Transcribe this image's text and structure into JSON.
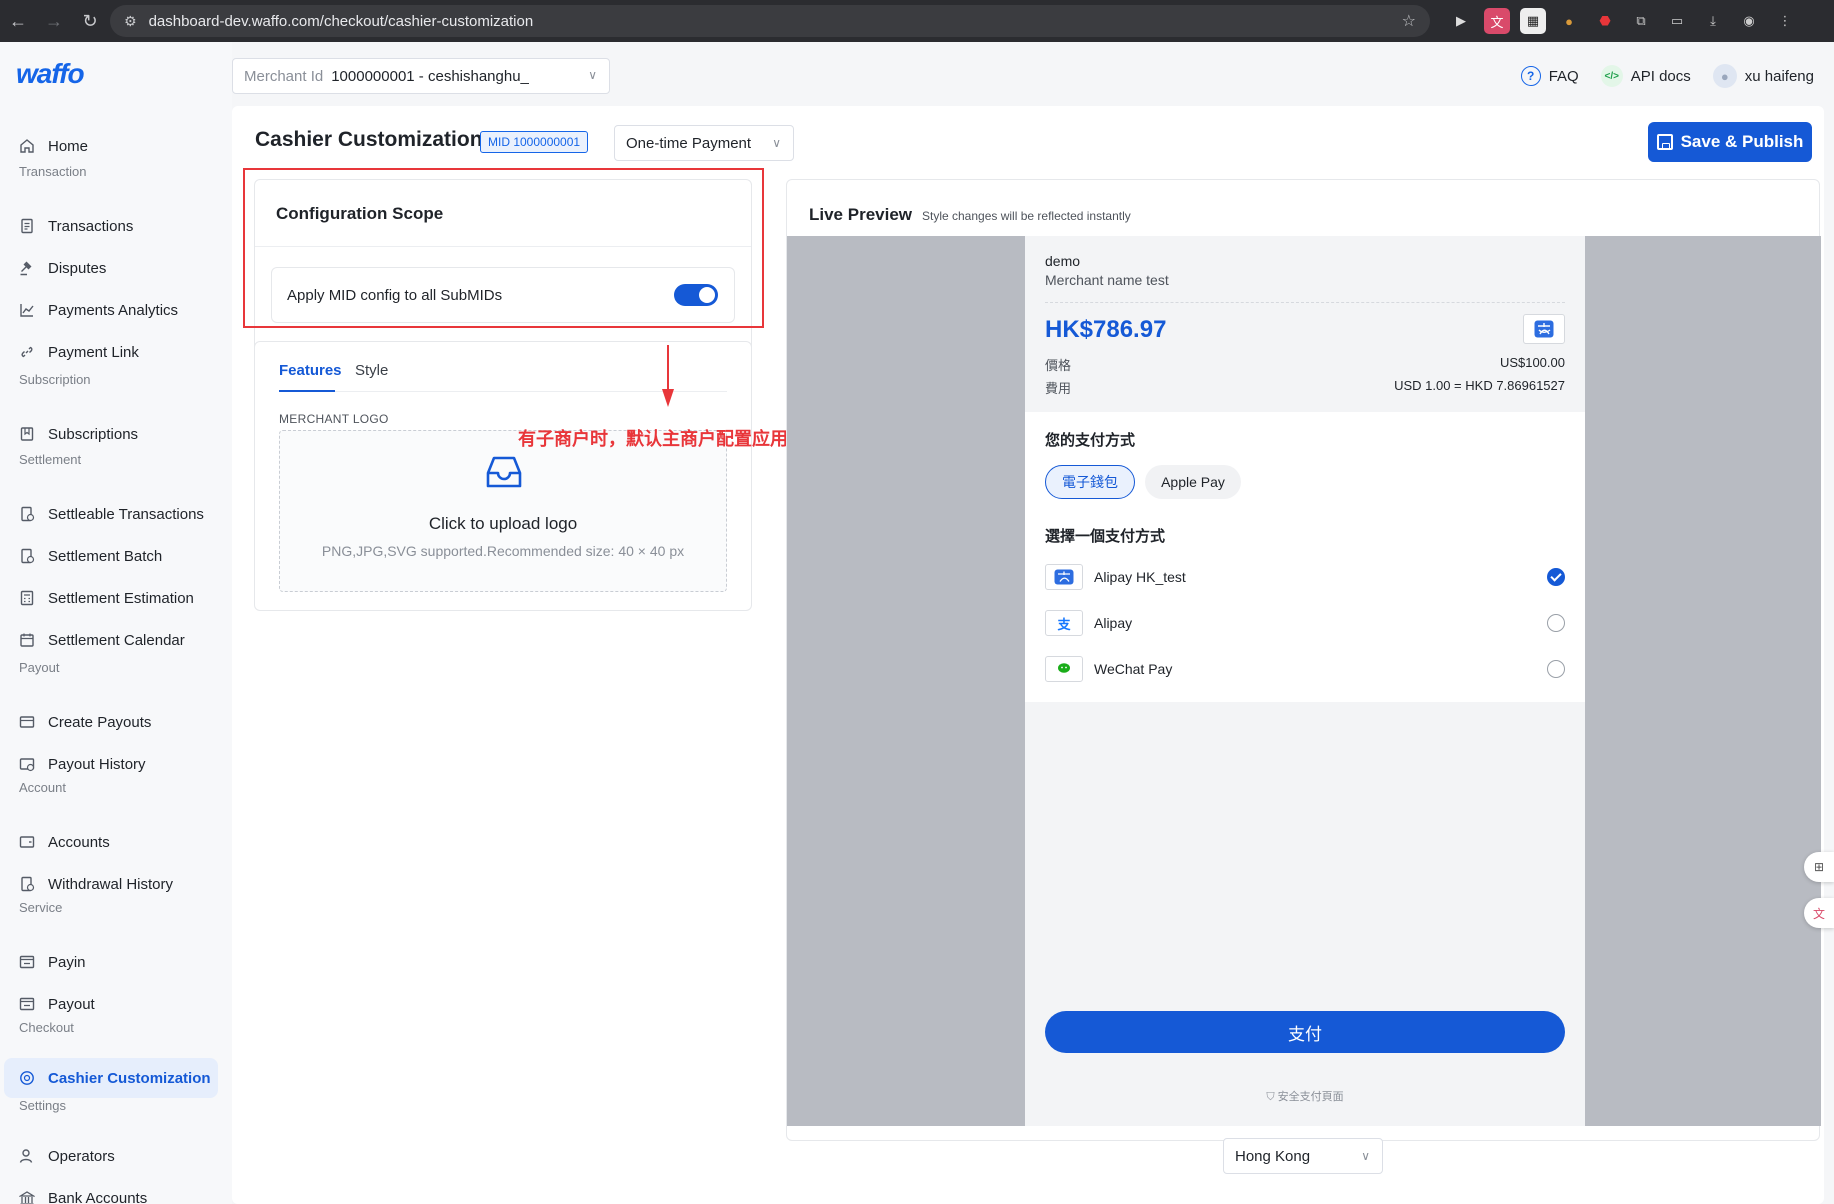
{
  "browser": {
    "url": "dashboard-dev.waffo.com/checkout/cashier-customization"
  },
  "brand": {
    "logo_text": "waffo",
    "accent": "#1559d6"
  },
  "header": {
    "merchant_label": "Merchant Id",
    "merchant_value": "1000000001 - ceshishanghu_",
    "faq": "FAQ",
    "api_docs": "API docs",
    "user_name": "xu haifeng"
  },
  "sidebar": {
    "home": "Home",
    "sections": {
      "transaction": "Transaction",
      "subscription": "Subscription",
      "settlement": "Settlement",
      "payout": "Payout",
      "account": "Account",
      "service": "Service",
      "checkout": "Checkout",
      "settings": "Settings"
    },
    "items": {
      "transactions": "Transactions",
      "disputes": "Disputes",
      "payments_analytics": "Payments Analytics",
      "payment_link": "Payment Link",
      "subscriptions": "Subscriptions",
      "settleable_transactions": "Settleable Transactions",
      "settlement_batch": "Settlement Batch",
      "settlement_estimation": "Settlement Estimation",
      "settlement_calendar": "Settlement Calendar",
      "create_payouts": "Create Payouts",
      "payout_history": "Payout History",
      "accounts": "Accounts",
      "withdrawal_history": "Withdrawal History",
      "payin": "Payin",
      "payout": "Payout",
      "cashier_customization": "Cashier Customization",
      "operators": "Operators",
      "bank_accounts": "Bank Accounts"
    }
  },
  "page": {
    "title": "Cashier Customization",
    "mid_badge": "MID 1000000001",
    "payment_type": "One-time Payment",
    "save_publish": "Save & Publish"
  },
  "scope": {
    "title": "Configuration Scope",
    "toggle_label": "Apply MID config to all SubMIDs",
    "toggle_on": true
  },
  "features": {
    "tab_features": "Features",
    "tab_style": "Style",
    "logo_label": "MERCHANT LOGO",
    "upload_title": "Click to upload logo",
    "upload_hint": "PNG,JPG,SVG supported.Recommended size: 40 × 40 px"
  },
  "annotation": {
    "text": "有子商户时，默认主商户配置应用到所有子商户",
    "color": "#e8363a"
  },
  "preview": {
    "title": "Live Preview",
    "subtitle": "Style changes will be reflected instantly",
    "merchant": "demo",
    "merchant_name": "Merchant name test",
    "amount": "HK$786.97",
    "price_label": "價格",
    "price_value": "US$100.00",
    "fee_label": "費用",
    "fee_value": "USD 1.00 = HKD 7.86961527",
    "your_method": "您的支付方式",
    "method_ewallet": "電子錢包",
    "method_applepay": "Apple Pay",
    "choose_method": "選擇一個支付方式",
    "methods": [
      {
        "name": "Alipay HK_test",
        "selected": true
      },
      {
        "name": "Alipay",
        "selected": false
      },
      {
        "name": "WeChat Pay",
        "selected": false
      }
    ],
    "pay_button": "支付",
    "secure_text": "安全支付頁面"
  },
  "region": {
    "value": "Hong Kong"
  }
}
